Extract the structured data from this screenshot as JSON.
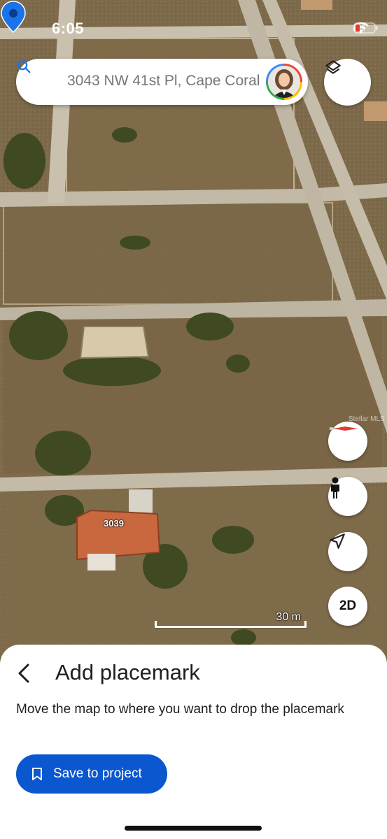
{
  "status_bar": {
    "time": "6:05"
  },
  "search": {
    "text": "3043 NW 41st Pl, Cape Coral"
  },
  "map": {
    "house_label": "3039",
    "watermark": "Stellar MLS",
    "scale_label": "30 m",
    "mode_button_label": "2D",
    "icons": [
      "layers-icon",
      "compass-icon",
      "pegman-icon",
      "my-location-icon",
      "placemark-pin-icon"
    ]
  },
  "sheet": {
    "title": "Add placemark",
    "description": "Move the map to where you want to drop the placemark",
    "save_button_label": "Save to project"
  },
  "colors": {
    "accent": "#0b57d0",
    "pin": "#1a73e8",
    "compass_red": "#e53935"
  }
}
